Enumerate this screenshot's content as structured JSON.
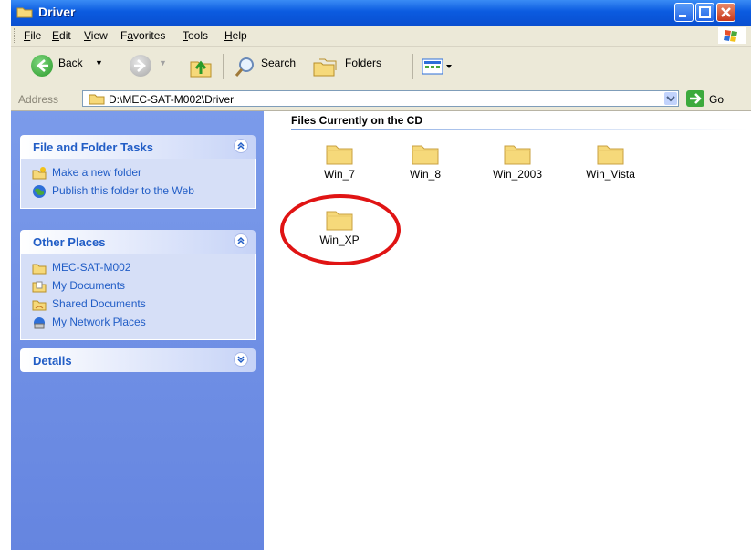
{
  "window": {
    "title": "Driver"
  },
  "menu": {
    "items": [
      {
        "label": "File",
        "accel": "F",
        "rest": "ile"
      },
      {
        "label": "Edit",
        "accel": "E",
        "rest": "dit"
      },
      {
        "label": "View",
        "accel": "V",
        "rest": "iew"
      },
      {
        "label": "Favorites",
        "pre": "F",
        "accel": "a",
        "rest": "vorites"
      },
      {
        "label": "Tools",
        "accel": "T",
        "rest": "ools"
      },
      {
        "label": "Help",
        "accel": "H",
        "rest": "elp"
      }
    ]
  },
  "toolbar": {
    "back_label": "Back",
    "search_label": "Search",
    "folders_label": "Folders"
  },
  "address": {
    "label": "Address",
    "value": "D:\\MEC-SAT-M002\\Driver",
    "go_label": "Go"
  },
  "sidebar": {
    "file_tasks": {
      "title": "File and Folder Tasks",
      "items": [
        {
          "label": "Make a new folder",
          "icon": "new-folder-icon"
        },
        {
          "label": "Publish this folder to the Web",
          "icon": "publish-web-icon"
        }
      ]
    },
    "other_places": {
      "title": "Other Places",
      "items": [
        {
          "label": "MEC-SAT-M002",
          "icon": "folder-icon"
        },
        {
          "label": "My Documents",
          "icon": "my-documents-icon"
        },
        {
          "label": "Shared Documents",
          "icon": "shared-documents-icon"
        },
        {
          "label": "My Network Places",
          "icon": "network-places-icon"
        }
      ]
    },
    "details": {
      "title": "Details"
    }
  },
  "content": {
    "group_title": "Files Currently on the CD",
    "files": [
      {
        "name": "Win_7"
      },
      {
        "name": "Win_8"
      },
      {
        "name": "Win_2003"
      },
      {
        "name": "Win_Vista"
      },
      {
        "name": "Win_XP"
      }
    ]
  },
  "colors": {
    "titlebar": "#0b5be0",
    "sidepane": "#7b9bea",
    "panel_text": "#215dc6",
    "highlight": "#e01414",
    "folder": "#f6d97a"
  }
}
